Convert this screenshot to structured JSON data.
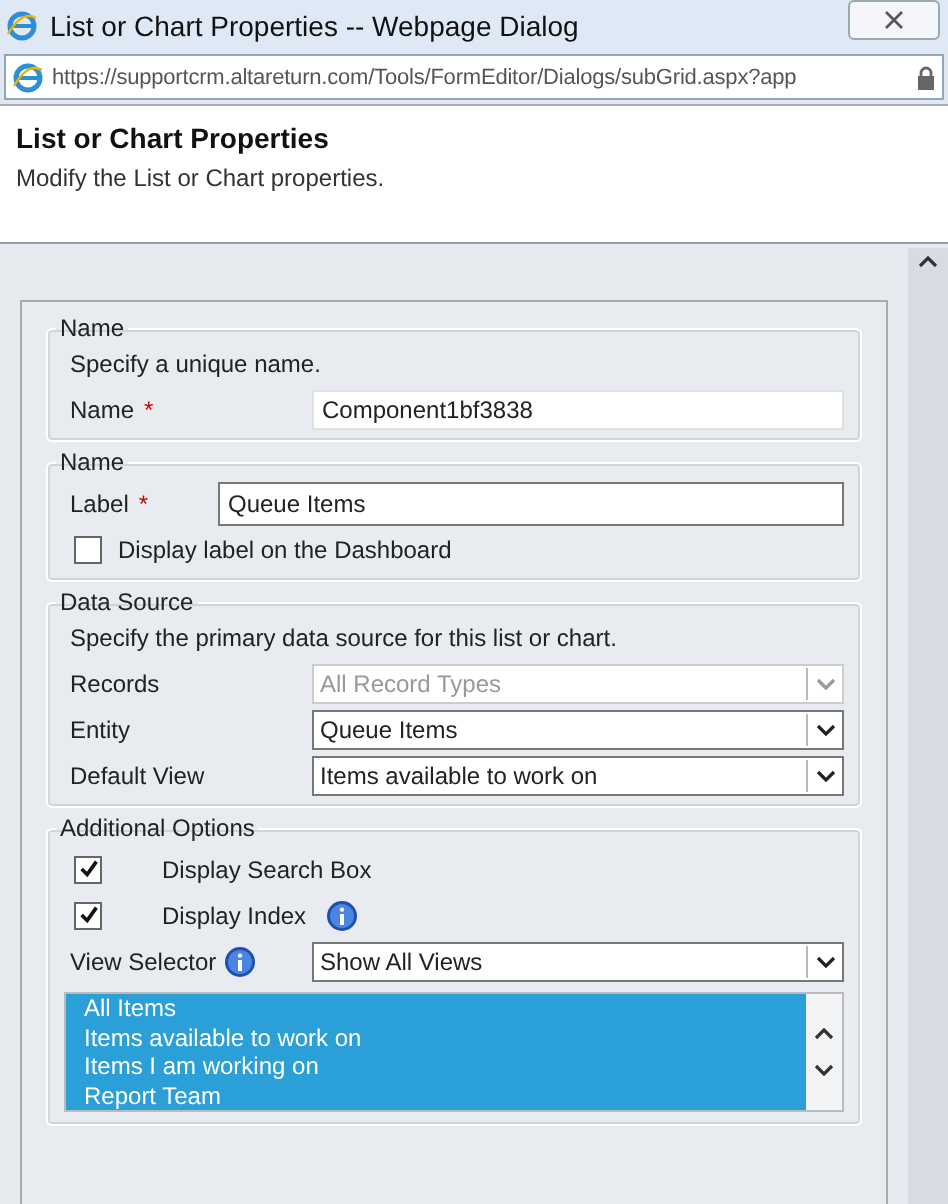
{
  "window": {
    "title": "List or Chart Properties -- Webpage Dialog"
  },
  "address_bar": {
    "url": "https://supportcrm.altareturn.com/Tools/FormEditor/Dialogs/subGrid.aspx?app"
  },
  "header": {
    "title": "List or Chart Properties",
    "subtitle": "Modify the List or Chart properties."
  },
  "sections": [
    {
      "legend": "Name",
      "description": "Specify a unique name.",
      "fields": [
        {
          "kind": "text",
          "label": "Name",
          "required_mark": "*",
          "value": "Component1bf3838"
        }
      ]
    },
    {
      "legend": "Name",
      "fields": [
        {
          "kind": "text",
          "label": "Label",
          "required_mark": "*",
          "value": "Queue Items"
        },
        {
          "kind": "checkbox",
          "label": "Display label on the Dashboard",
          "checked": false
        }
      ]
    },
    {
      "legend": "Data Source",
      "description": "Specify the primary data source for this list or chart.",
      "fields": [
        {
          "kind": "select",
          "label": "Records",
          "value": "All Record Types",
          "disabled": true
        },
        {
          "kind": "select",
          "label": "Entity",
          "value": "Queue Items",
          "disabled": false
        },
        {
          "kind": "select",
          "label": "Default View",
          "value": "Items available to work on",
          "disabled": false
        }
      ]
    },
    {
      "legend": "Additional Options",
      "fields": [
        {
          "kind": "checkbox",
          "label": "Display Search Box",
          "checked": true
        },
        {
          "kind": "checkbox",
          "label": "Display Index",
          "checked": true,
          "info": true
        },
        {
          "kind": "select",
          "label": "View Selector",
          "value": "Show All Views",
          "disabled": false,
          "info": true
        },
        {
          "kind": "listbox",
          "items": [
            {
              "label": "All Items",
              "selected": true
            },
            {
              "label": "Items available to work on",
              "selected": true
            },
            {
              "label": "Items I am working on",
              "selected": true
            },
            {
              "label": "Report Team",
              "selected": true
            }
          ]
        }
      ]
    }
  ]
}
